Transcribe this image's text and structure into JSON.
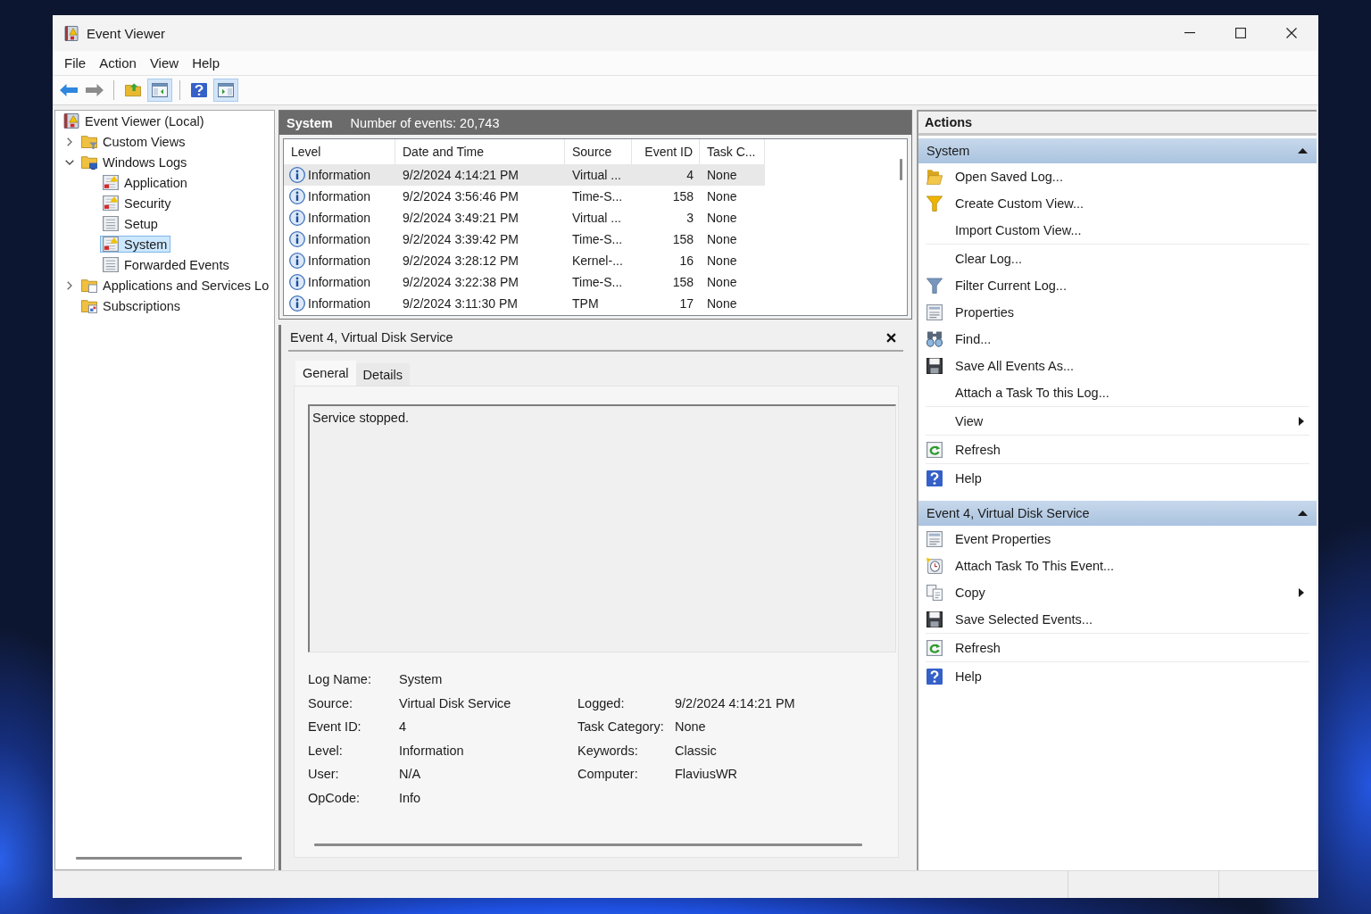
{
  "window": {
    "title": "Event Viewer"
  },
  "menu": [
    "File",
    "Action",
    "View",
    "Help"
  ],
  "toolbar": {
    "groups": [
      [
        {
          "pressed": false,
          "disabled": false
        },
        {
          "pressed": false,
          "disabled": true
        }
      ],
      [
        {
          "pressed": false,
          "disabled": false
        },
        {
          "pressed": true,
          "disabled": false
        }
      ],
      [
        {
          "pressed": false,
          "disabled": false
        },
        {
          "pressed": true,
          "disabled": false
        }
      ]
    ]
  },
  "tree": [
    {
      "label": "Event Viewer (Local)",
      "selected": false,
      "children": [
        {
          "label": "Custom Views",
          "selected": false,
          "expanded": false
        },
        {
          "label": "Windows Logs",
          "selected": false,
          "expanded": true,
          "children": [
            {
              "label": "Application",
              "selected": false
            },
            {
              "label": "Security",
              "selected": false
            },
            {
              "label": "Setup",
              "selected": false
            },
            {
              "label": "System",
              "selected": true
            },
            {
              "label": "Forwarded Events",
              "selected": false
            }
          ]
        },
        {
          "label": "Applications and Services Lo",
          "selected": false,
          "expanded": false
        },
        {
          "label": "Subscriptions",
          "selected": false
        }
      ]
    }
  ],
  "event_list": {
    "title": "System",
    "count": "Number of events: 20,743",
    "columns": [
      "Level",
      "Date and Time",
      "Source",
      "Event ID",
      "Task C..."
    ],
    "rows": [
      {
        "selected": true,
        "cells": [
          "Information",
          "9/2/2024 4:14:21 PM",
          "Virtual ...",
          "4",
          "None"
        ]
      },
      {
        "selected": false,
        "cells": [
          "Information",
          "9/2/2024 3:56:46 PM",
          "Time-S...",
          "158",
          "None"
        ]
      },
      {
        "selected": false,
        "cells": [
          "Information",
          "9/2/2024 3:49:21 PM",
          "Virtual ...",
          "3",
          "None"
        ]
      },
      {
        "selected": false,
        "cells": [
          "Information",
          "9/2/2024 3:39:42 PM",
          "Time-S...",
          "158",
          "None"
        ]
      },
      {
        "selected": false,
        "cells": [
          "Information",
          "9/2/2024 3:28:12 PM",
          "Kernel-...",
          "16",
          "None"
        ]
      },
      {
        "selected": false,
        "cells": [
          "Information",
          "9/2/2024 3:22:38 PM",
          "Time-S...",
          "158",
          "None"
        ]
      },
      {
        "selected": false,
        "cells": [
          "Information",
          "9/2/2024 3:11:30 PM",
          "TPM",
          "17",
          "None"
        ]
      }
    ]
  },
  "event_detail": {
    "title": "Event 4, Virtual Disk Service",
    "tabs": [
      {
        "label": "General",
        "selected": true
      },
      {
        "label": "Details",
        "selected": false
      }
    ],
    "message": "Service stopped.",
    "fields": [
      [
        {
          "label": "Log Name:",
          "value": "System"
        }
      ],
      [
        {
          "label": "Source:",
          "value": "Virtual Disk Service"
        },
        {
          "label": "Logged:",
          "value": "9/2/2024 4:14:21 PM"
        }
      ],
      [
        {
          "label": "Event ID:",
          "value": "4"
        },
        {
          "label": "Task Category:",
          "value": "None"
        }
      ],
      [
        {
          "label": "Level:",
          "value": "Information"
        },
        {
          "label": "Keywords:",
          "value": "Classic"
        }
      ],
      [
        {
          "label": "User:",
          "value": "N/A"
        },
        {
          "label": "Computer:",
          "value": "FlaviusWR"
        }
      ],
      [
        {
          "label": "OpCode:",
          "value": "Info"
        }
      ]
    ]
  },
  "actions": {
    "title": "Actions",
    "sections": [
      {
        "title": "System",
        "expanded": true,
        "groups": [
          [
            {
              "label": "Open Saved Log...",
              "submenu": false
            },
            {
              "label": "Create Custom View...",
              "submenu": false
            },
            {
              "label": "Import Custom View...",
              "submenu": false
            }
          ],
          [
            {
              "label": "Clear Log...",
              "submenu": false
            },
            {
              "label": "Filter Current Log...",
              "submenu": false
            },
            {
              "label": "Properties",
              "submenu": false
            },
            {
              "label": "Find...",
              "submenu": false
            },
            {
              "label": "Save All Events As...",
              "submenu": false
            },
            {
              "label": "Attach a Task To this Log...",
              "submenu": false
            }
          ],
          [
            {
              "label": "View",
              "submenu": true
            }
          ],
          [
            {
              "label": "Refresh",
              "submenu": false
            }
          ],
          [
            {
              "label": "Help",
              "submenu": false
            }
          ]
        ]
      },
      {
        "title": "Event 4, Virtual Disk Service",
        "expanded": true,
        "groups": [
          [
            {
              "label": "Event Properties",
              "submenu": false
            },
            {
              "label": "Attach Task To This Event...",
              "submenu": false
            },
            {
              "label": "Copy",
              "submenu": true
            },
            {
              "label": "Save Selected Events...",
              "submenu": false
            }
          ],
          [
            {
              "label": "Refresh",
              "submenu": false
            }
          ],
          [
            {
              "label": "Help",
              "submenu": false
            }
          ]
        ]
      }
    ]
  }
}
